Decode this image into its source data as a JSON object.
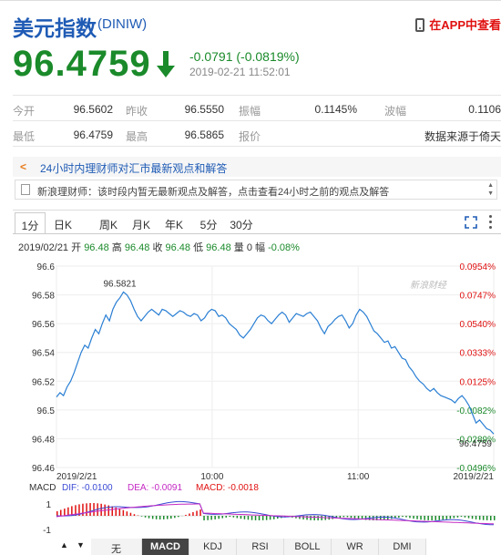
{
  "header": {
    "title": "美元指数",
    "code": "(DINIW)",
    "app_link": "在APP中查看"
  },
  "quote": {
    "price": "96.4759",
    "change": "-0.0791 (-0.0819%)",
    "timestamp": "2019-02-21 11:52:01",
    "up_color": "#e01010",
    "down_color": "#1a8a2a"
  },
  "table": {
    "row1": {
      "open_label": "今开",
      "open": "96.5602",
      "prev_label": "昨收",
      "prev": "96.5550",
      "amp_label": "振幅",
      "amp": "0.1145%",
      "wave_label": "波幅",
      "wave": "0.1106"
    },
    "row2": {
      "low_label": "最低",
      "low": "96.4759",
      "high_label": "最高",
      "high": "96.5865",
      "price_label": "报价",
      "source": "数据来源于倚天"
    }
  },
  "news": {
    "title": "24小时内理财师对汇市最新观点和解答",
    "message": "新浪理财师：该时段内暂无最新观点及解答，点击查看24小时之前的观点及解答"
  },
  "tabs": [
    "1分",
    "日K",
    "周K",
    "月K",
    "年K",
    "5分",
    "30分"
  ],
  "info": {
    "date": "2019/02/21",
    "open_label": "开",
    "open": "96.48",
    "high_label": "高",
    "high": "96.48",
    "close_label": "收",
    "close": "96.48",
    "low_label": "低",
    "low": "96.48",
    "vol_label": "量",
    "vol": "0",
    "pct_label": "幅",
    "pct": "-0.08%"
  },
  "chart_data": {
    "type": "line",
    "watermark": "新浪财经",
    "ylim": [
      96.46,
      96.6
    ],
    "y_ticks": [
      "96.6",
      "96.58",
      "96.56",
      "96.54",
      "96.52",
      "96.5",
      "96.48",
      "96.46"
    ],
    "pct_ticks": [
      {
        "label": "0.0954%",
        "color": "#e01010"
      },
      {
        "label": "0.0747%",
        "color": "#e01010"
      },
      {
        "label": "0.0540%",
        "color": "#e01010"
      },
      {
        "label": "0.0333%",
        "color": "#e01010"
      },
      {
        "label": "0.0125%",
        "color": "#e01010"
      },
      {
        "label": "-0.0082%",
        "color": "#1a8a2a"
      },
      {
        "label": "-0.0289%",
        "color": "#1a8a2a"
      },
      {
        "label": "-0.0496%",
        "color": "#1a8a2a"
      }
    ],
    "x_ticks": [
      "2019/2/21",
      "10:00",
      "11:00",
      "2019/2/21"
    ],
    "x_tick_fracs": [
      0.0,
      0.356,
      0.69,
      1.0
    ],
    "series": [
      {
        "values": [
          96.509,
          96.512,
          96.51,
          96.516,
          96.52,
          96.526,
          96.533,
          96.54,
          96.545,
          96.543,
          96.55,
          96.556,
          96.553,
          96.56,
          96.566,
          96.562,
          96.57,
          96.575,
          96.578,
          96.582,
          96.58,
          96.576,
          96.57,
          96.565,
          96.562,
          96.565,
          96.568,
          96.57,
          96.568,
          96.566,
          96.57,
          96.569,
          96.567,
          96.565,
          96.567,
          96.569,
          96.568,
          96.566,
          96.565,
          96.567,
          96.566,
          96.562,
          96.564,
          96.568,
          96.57,
          96.569,
          96.565,
          96.566,
          96.564,
          96.56,
          96.558,
          96.556,
          96.552,
          96.55,
          96.553,
          96.556,
          96.56,
          96.564,
          96.566,
          96.565,
          96.562,
          96.56,
          96.563,
          96.566,
          96.568,
          96.566,
          96.561,
          96.564,
          96.567,
          96.566,
          96.565,
          96.567,
          96.568,
          96.565,
          96.562,
          96.557,
          96.553,
          96.558,
          96.56,
          96.563,
          96.565,
          96.566,
          96.562,
          96.557,
          96.56,
          96.566,
          96.57,
          96.568,
          96.565,
          96.56,
          96.555,
          96.553,
          96.55,
          96.547,
          96.548,
          96.543,
          96.544,
          96.54,
          96.536,
          96.535,
          96.53,
          96.527,
          96.523,
          96.52,
          96.518,
          96.515,
          96.513,
          96.515,
          96.512,
          96.51,
          96.509,
          96.508,
          96.507,
          96.505,
          96.508,
          96.51,
          96.507,
          96.503,
          96.497,
          96.491,
          96.493,
          96.49,
          96.487,
          96.486,
          96.4833
        ],
        "color": "#2a7fd4"
      }
    ],
    "annotations": [
      {
        "text": "96.5821",
        "at": "high",
        "index": 19
      },
      {
        "text": "96.4759",
        "at": "last"
      }
    ]
  },
  "macd": {
    "label": "MACD",
    "dif": "DIF: -0.0100",
    "dea": "DEA: -0.0091",
    "macd": "MACD: -0.0018",
    "y_top": "1",
    "y_bottom": "-1"
  },
  "bottom_tabs": [
    "无",
    "MACD",
    "KDJ",
    "RSI",
    "BOLL",
    "WR",
    "DMI"
  ],
  "nav": {
    "up": "▲",
    "down": "▼"
  }
}
